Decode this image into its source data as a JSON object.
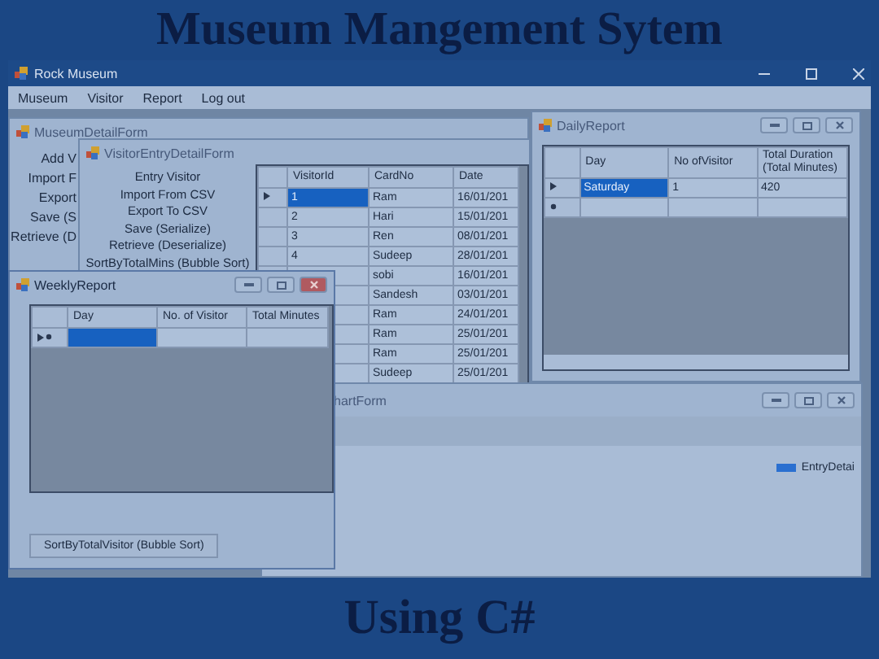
{
  "banner": {
    "title": "Museum Mangement Sytem"
  },
  "app": {
    "title": "Rock Museum",
    "menu": [
      "Museum",
      "Visitor",
      "Report",
      "Log out"
    ]
  },
  "museum_form": {
    "title": "MuseumDetailForm",
    "buttons": [
      "Add V",
      "Import F",
      "Export",
      "Save (S",
      "Retrieve (D"
    ]
  },
  "visitor_form": {
    "title": "VisitorEntryDetailForm",
    "buttons": [
      "Entry Visitor",
      "Import From CSV",
      "Export To CSV",
      "Save (Serialize)",
      "Retrieve (Deserialize)",
      "SortByTotalMins (Bubble Sort)"
    ],
    "table": {
      "columns": [
        "VisitorId",
        "CardNo",
        "Date"
      ],
      "rows": [
        {
          "id": "1",
          "card_no": "Ram",
          "date": "16/01/201",
          "selected": true
        },
        {
          "id": "2",
          "card_no": "Hari",
          "date": "15/01/201",
          "selected": false
        },
        {
          "id": "3",
          "card_no": "Ren",
          "date": "08/01/201",
          "selected": false
        },
        {
          "id": "4",
          "card_no": "Sudeep",
          "date": "28/01/201",
          "selected": false
        },
        {
          "card_no": "sobi",
          "date": "16/01/201",
          "selected": false
        },
        {
          "card_no": "Sandesh",
          "date": "03/01/201",
          "selected": false
        },
        {
          "card_no": "Ram",
          "date": "24/01/201",
          "selected": false
        },
        {
          "card_no": "Ram",
          "date": "25/01/201",
          "selected": false
        },
        {
          "card_no": "Ram",
          "date": "25/01/201",
          "selected": false
        },
        {
          "card_no": "Sudeep",
          "date": "25/01/201",
          "selected": false
        }
      ]
    }
  },
  "daily_report": {
    "title": "DailyReport",
    "columns": [
      "Day",
      "No ofVisitor",
      "Total Duration (Total Minutes)"
    ],
    "rows": [
      {
        "kind": "data",
        "cells": [
          "Saturday",
          "1",
          "420"
        ],
        "selected": true
      },
      {
        "kind": "new",
        "selected": false
      }
    ]
  },
  "chart_form": {
    "title": "hartForm",
    "legend": [
      {
        "label": "EntryDetai",
        "color": "#2a6fd0"
      }
    ]
  },
  "weekly_report": {
    "title": "WeeklyReport",
    "columns": [
      "Day",
      "No. of Visitor",
      "Total Minutes"
    ],
    "rows": [
      {
        "kind": "new",
        "selected": true
      }
    ],
    "button": "SortByTotalVisitor (Bubble Sort)"
  },
  "footer": {
    "text": "Using C#"
  }
}
